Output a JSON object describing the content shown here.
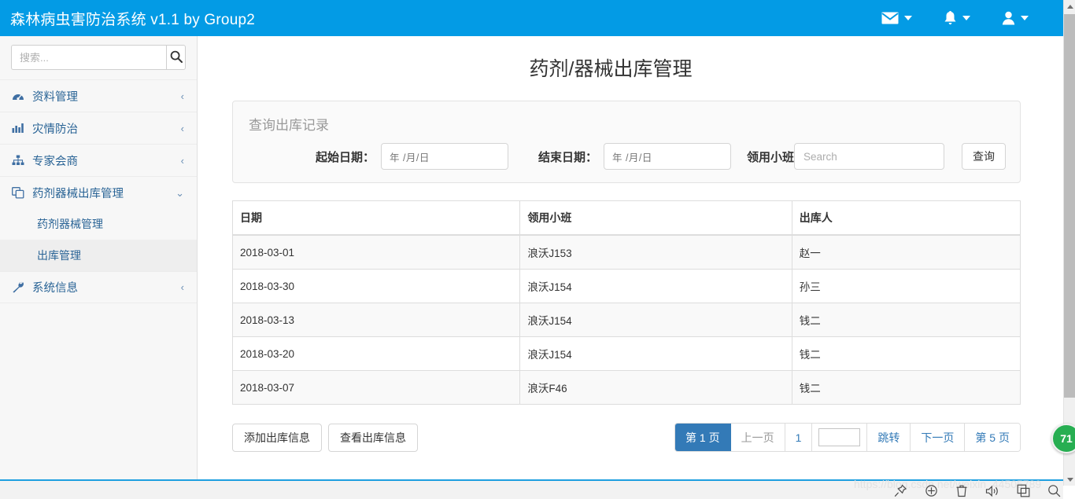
{
  "navbar": {
    "brand": "森林病虫害防治系统 v1.1 by Group2",
    "items": [
      {
        "icon": "envelope-icon",
        "name": "messages-menu"
      },
      {
        "icon": "bell-icon",
        "name": "notifications-menu"
      },
      {
        "icon": "user-icon",
        "name": "account-menu"
      }
    ],
    "accent_color": "#039be5"
  },
  "sidebar": {
    "search": {
      "placeholder": "搜索...",
      "value": "",
      "button_icon": "search-icon"
    },
    "menu": [
      {
        "label": "资料管理",
        "icon": "dashboard-icon",
        "chevron": "‹",
        "expanded": false
      },
      {
        "label": "灾情防治",
        "icon": "bar-chart-icon",
        "chevron": "‹",
        "expanded": false
      },
      {
        "label": "专家会商",
        "icon": "sitemap-icon",
        "chevron": "‹",
        "expanded": false
      },
      {
        "label": "药剂器械出库管理",
        "icon": "clone-icon",
        "chevron": "⌄",
        "expanded": true
      },
      {
        "label": "系统信息",
        "icon": "wrench-icon",
        "chevron": "‹",
        "expanded": false
      }
    ],
    "submenu": [
      {
        "label": "药剂器械管理",
        "active": false
      },
      {
        "label": "出库管理",
        "active": true
      }
    ]
  },
  "main": {
    "title": "药剂/器械出库管理",
    "query_panel": {
      "heading": "查询出库记录",
      "start_date_label": "起始日期：",
      "start_date_placeholder": "年 /月/日",
      "start_date_value": "",
      "end_date_label": "结束日期：",
      "end_date_placeholder": "年 /月/日",
      "end_date_value": "",
      "team_label": "领用小班",
      "team_placeholder": "Search",
      "team_value": "",
      "query_button": "查询"
    },
    "table": {
      "columns": [
        "日期",
        "领用小班",
        "出库人"
      ],
      "rows": [
        [
          "2018-03-01",
          "浪沃J153",
          "赵一"
        ],
        [
          "2018-03-30",
          "浪沃J154",
          "孙三"
        ],
        [
          "2018-03-13",
          "浪沃J154",
          "钱二"
        ],
        [
          "2018-03-20",
          "浪沃J154",
          "钱二"
        ],
        [
          "2018-03-07",
          "浪沃F46",
          "钱二"
        ]
      ]
    },
    "actions": {
      "add_button": "添加出库信息",
      "view_button": "查看出库信息"
    },
    "pagination": {
      "current_page_label": "第 1 页",
      "prev_label": "上一页",
      "page_number": "1",
      "jump_input_value": "",
      "jump_label": "跳转",
      "next_label": "下一页",
      "last_page_label": "第 5 页",
      "active_color": "#337ab7"
    }
  },
  "chrome": {
    "watermark": "https://blog.csdn.net/weixin_44505789",
    "tool_icons": [
      "pin-icon",
      "refresh-icon",
      "trash-icon",
      "speaker-icon",
      "window-copy-icon",
      "search-icon"
    ],
    "badge_count": "71"
  }
}
